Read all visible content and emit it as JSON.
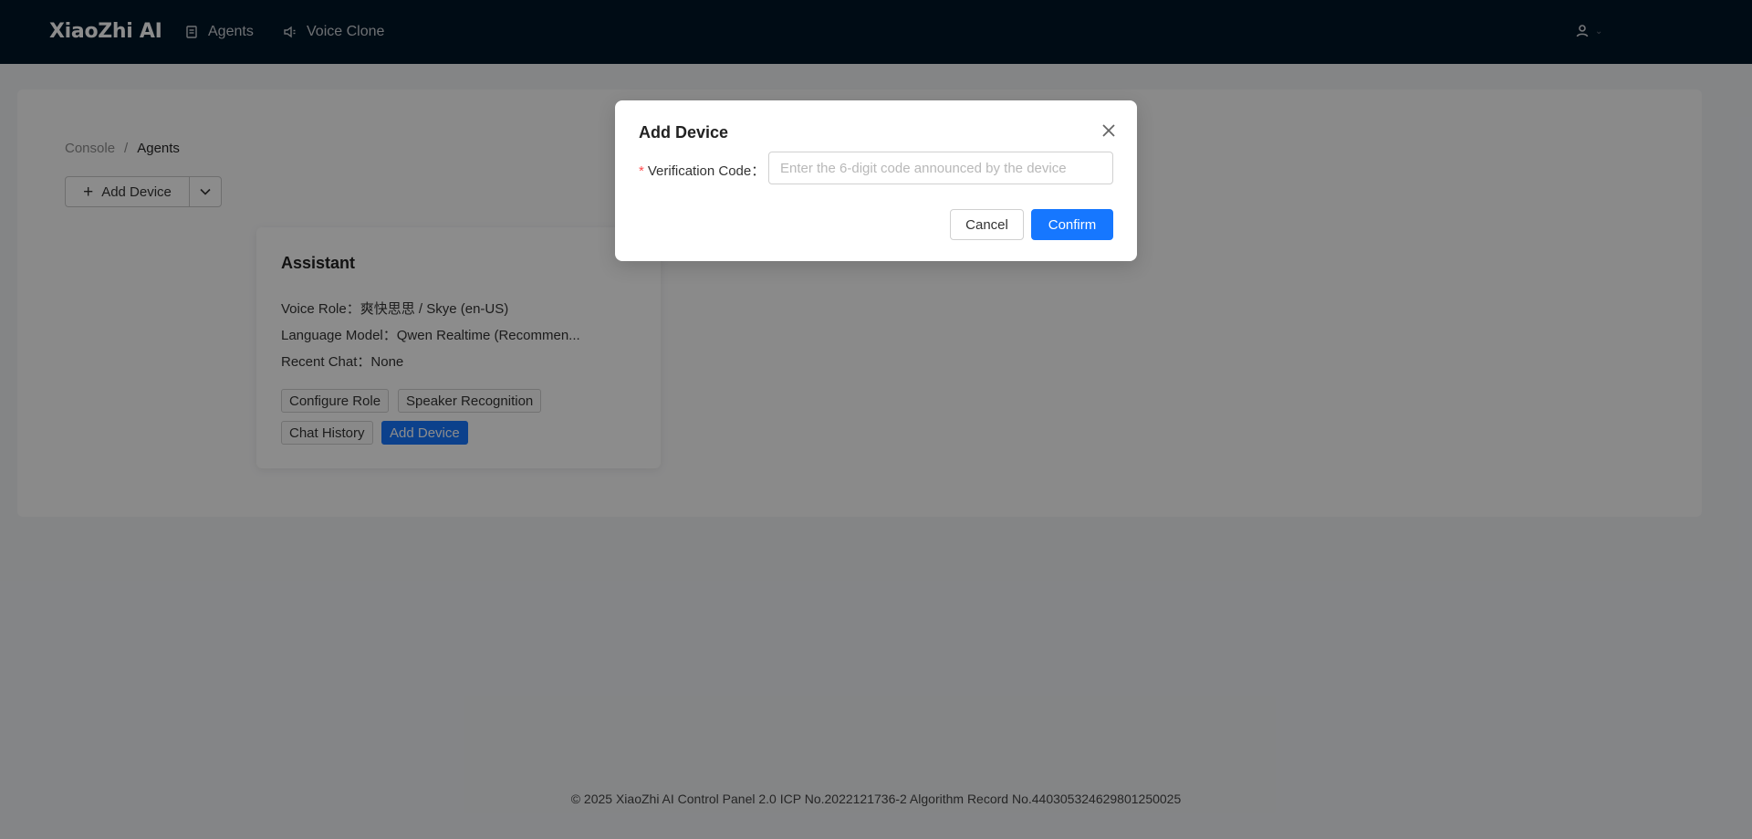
{
  "header": {
    "brand": "XiaoZhi AI",
    "nav": [
      {
        "label": "Agents",
        "icon": "document-icon"
      },
      {
        "label": "Voice Clone",
        "icon": "speaker-icon"
      }
    ],
    "user_icon": "user-icon"
  },
  "breadcrumb": {
    "root": "Console",
    "separator": "/",
    "current": "Agents"
  },
  "toolbar": {
    "add_device_label": "Add Device",
    "add_icon": "+"
  },
  "agent_card": {
    "title": "Assistant",
    "voice_role_label": "Voice Role：",
    "voice_role_value": "爽快思思 / Skye (en-US)",
    "language_model_label": "Language Model：",
    "language_model_value": "Qwen Realtime (Recommen...",
    "recent_chat_label": "Recent Chat：",
    "recent_chat_value": "None",
    "actions": {
      "configure_role": "Configure Role",
      "speaker_recognition": "Speaker Recognition",
      "chat_history": "Chat History",
      "add_device": "Add Device"
    }
  },
  "modal": {
    "title": "Add Device",
    "required_mark": "*",
    "field_label": "Verification Code：",
    "field_value": "",
    "field_placeholder": "Enter the 6-digit code announced by the device",
    "cancel_label": "Cancel",
    "confirm_label": "Confirm"
  },
  "footer": {
    "text": "© 2025 XiaoZhi AI Control Panel 2.0 ICP No.2022121736-2 Algorithm Record No.440305324629801250025"
  },
  "colors": {
    "header_bg": "#011627",
    "primary": "#1677ff",
    "required": "#ff4d4f"
  }
}
